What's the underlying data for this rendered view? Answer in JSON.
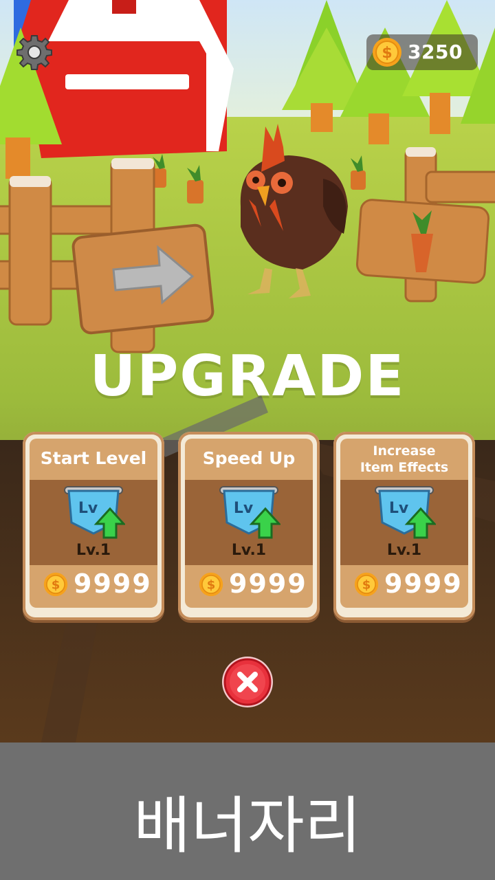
{
  "hud": {
    "coins": "3250"
  },
  "title": "UPGRADE",
  "cards": [
    {
      "label": "Start Level",
      "level": "Lv.1",
      "price": "9999",
      "badge_text": "Lv"
    },
    {
      "label": "Speed Up",
      "level": "Lv.1",
      "price": "9999",
      "badge_text": "Lv"
    },
    {
      "label_line1": "Increase",
      "label_line2": "Item Effects",
      "level": "Lv.1",
      "price": "9999",
      "badge_text": "Lv"
    }
  ],
  "banner": {
    "text": "배너자리"
  },
  "icons": {
    "settings": "gear-icon",
    "coin": "coin-icon",
    "close": "close-icon",
    "upgrade": "level-up-badge-icon"
  },
  "colors": {
    "close_button": "#e8313c",
    "card_border": "#c58d5a",
    "card_panel": "#d6a46d",
    "grass": "#9cc23e",
    "sky": "#d9ecf8"
  }
}
